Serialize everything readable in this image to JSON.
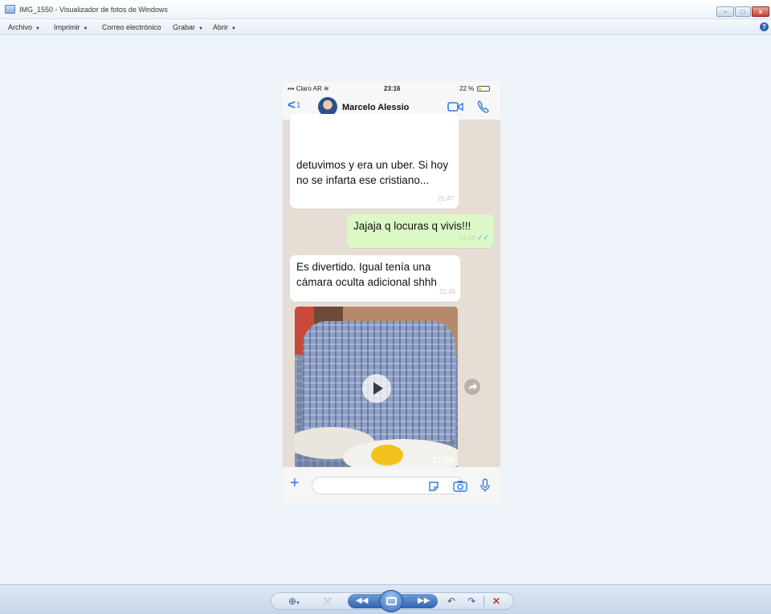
{
  "window": {
    "title": "IMG_1550 - Visualizador de fotos de Windows",
    "minimize": "–",
    "maximize": "□",
    "close": "x"
  },
  "menu": {
    "items": [
      {
        "label": "Archivo"
      },
      {
        "label": "Imprimir"
      },
      {
        "label": "Correo electrónico"
      },
      {
        "label": "Grabar"
      },
      {
        "label": "Abrir"
      }
    ],
    "help": "?"
  },
  "phone": {
    "status": {
      "carrier": "Claro AR",
      "time": "23:16",
      "battery": "22 %"
    },
    "chat": {
      "back_count": "1",
      "contact_name": "Marcelo Alessio",
      "messages": [
        {
          "text": "detuvimos y era un uber. Si hoy no se infarta ese cristiano...",
          "time": "21:47",
          "direction": "in"
        },
        {
          "text": "Jajaja q locuras q vivis!!!",
          "time": "21:48",
          "direction": "out"
        },
        {
          "text": "Es divertido. Igual tenía una cámara oculta adicional shhh",
          "time": "21:49",
          "direction": "in"
        }
      ],
      "video_time": "21:50"
    }
  },
  "toolbar": {
    "zoom": "⊕",
    "zoom_caret": "▾",
    "fit": "⤧",
    "prev": "◀◀",
    "next": "▶▶",
    "rotate_left": "↶",
    "rotate_right": "↷",
    "delete": "✕"
  },
  "colors": {
    "viewer_bg": "#eef3fa",
    "chat_bg": "#e6ded4",
    "outgoing_bubble": "#dcf8c6",
    "ios_blue": "#2f7ae5",
    "read_ticks": "#4fb6ec"
  }
}
